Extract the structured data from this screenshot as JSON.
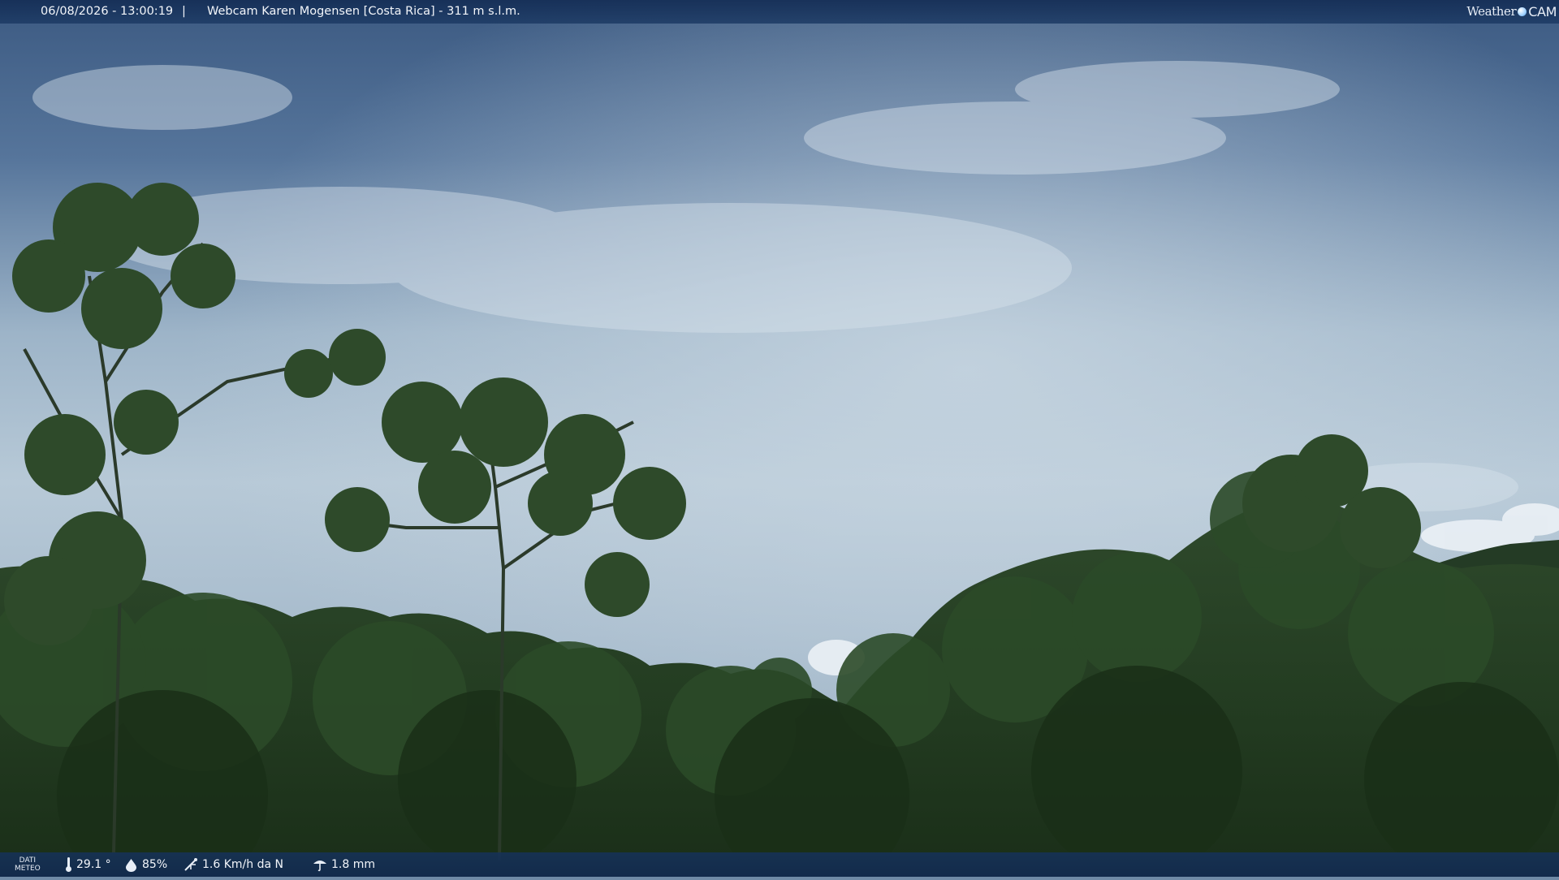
{
  "header": {
    "timestamp": "06/08/2026 - 13:00:19",
    "separator": "|",
    "title": "Webcam Karen Mogensen [Costa Rica] - 311 m s.l.m.",
    "logo_weather": "Weather",
    "logo_cam": "CAM"
  },
  "footer": {
    "meteo_label_1": "DATI",
    "meteo_label_2": "METEO",
    "temperature": "29.1 °",
    "humidity": "85%",
    "wind": "1.6 Km/h da N",
    "rain": "1.8 mm",
    "icons": [
      "thermometer-icon",
      "humidity-drop-icon",
      "wind-icon",
      "rain-icon"
    ]
  },
  "colors": {
    "bar": "#1c3a64",
    "sky_top": "#3f5e85",
    "sky_mid": "#b4c8d8",
    "foliage": "#1f3a1e"
  }
}
